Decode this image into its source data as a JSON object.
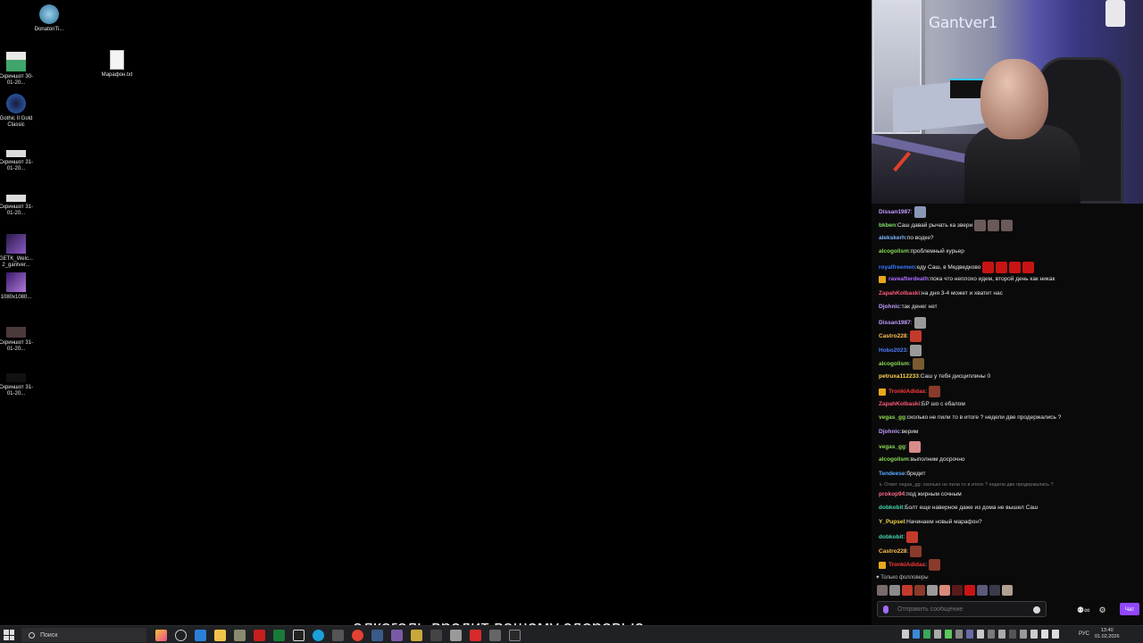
{
  "desktop": {
    "icons": [
      {
        "label": "DonatonTi...",
        "color": "#5aa0c8"
      },
      {
        "label": "Скриншот 30-01-20...",
        "color": "#3fa56a"
      },
      {
        "label": "Марафон.txt",
        "color": "#eeeeee"
      },
      {
        "label": "Gothic II Gold Classic",
        "color": "#2c6ac4"
      },
      {
        "label": "Скриншот 31-01-20...",
        "color": "#dcdcdc"
      },
      {
        "label": "Скриншот 31-01-20...",
        "color": "#dcdcdc"
      },
      {
        "label": "GETK_Welc... 2_gantver...",
        "color": "#5b3a8c"
      },
      {
        "label": "1080x1080...",
        "color": "#6b3fa0"
      },
      {
        "label": "Скриншот 31-01-20...",
        "color": "#4a3a3a"
      },
      {
        "label": "Скриншот 31-01-20...",
        "color": "#111111"
      }
    ]
  },
  "stream": {
    "streamer_name": "Gantver1"
  },
  "chat": {
    "messages": [
      {
        "user": "Dissan1987",
        "color": "#c29dff",
        "text": "",
        "emotes": [
          "#8a96b8"
        ],
        "badge": false
      },
      {
        "user": "bkben",
        "color": "#7ee06a",
        "text": "Саш давай рычать ка звери",
        "emotes": [
          "#6a5a5a",
          "#6a5a5a",
          "#6a5a5a"
        ],
        "badge": false
      },
      {
        "user": "alekskerh",
        "color": "#7ab7ff",
        "text": "по водке?",
        "emotes": [],
        "badge": false
      },
      {
        "user": "alcogolism",
        "color": "#8bdb55",
        "text": "проблемный курьер",
        "emotes": [],
        "badge": false
      },
      {
        "user": "royalfreemen",
        "color": "#3b78ff",
        "text": "еду Саш, в Медведково",
        "emotes": [
          "#c81414",
          "#c81414",
          "#c81414",
          "#c81414"
        ],
        "badge": false
      },
      {
        "user": "raveafterdeath",
        "color": "#b26dff",
        "text": "пока что неплохо идем, второй день как никак",
        "emotes": [],
        "badge": true
      },
      {
        "user": "ZapahKolbaski",
        "color": "#ff5a7a",
        "text": "на дня 3-4 может и хватит нас",
        "emotes": [],
        "badge": false
      },
      {
        "user": "Djohnic",
        "color": "#c29dff",
        "text": "так денег нет",
        "emotes": [],
        "badge": false
      },
      {
        "user": "Dissan1987",
        "color": "#c29dff",
        "text": "",
        "emotes": [
          "#9a9a9a"
        ],
        "badge": false
      },
      {
        "user": "Castro228",
        "color": "#ffc04d",
        "text": "",
        "emotes": [
          "#c43a2a"
        ],
        "badge": false
      },
      {
        "user": "Hobo2023",
        "color": "#4f7dff",
        "text": "",
        "emotes": [
          "#9a9a9a"
        ],
        "badge": false
      },
      {
        "user": "alcogolism",
        "color": "#8bdb55",
        "text": "",
        "emotes": [
          "#7a5a30"
        ],
        "badge": false
      },
      {
        "user": "petruxa112233",
        "color": "#ffd24d",
        "text": "Саш у тебя дисциплины 0",
        "emotes": [],
        "badge": false
      },
      {
        "user": "TronkiAdidas",
        "color": "#ff3b3b",
        "text": "",
        "emotes": [
          "#8a3a2a"
        ],
        "badge": true
      },
      {
        "user": "ZapahKolbaski",
        "color": "#ff5a7a",
        "text": "БР шо с ебалом",
        "emotes": [],
        "badge": false
      },
      {
        "user": "vegas_gg",
        "color": "#8bdb55",
        "text": "сколько не пили то в итоге ? недели две продержались ?",
        "emotes": [],
        "badge": false
      },
      {
        "user": "Djohnic",
        "color": "#c29dff",
        "text": "верим",
        "emotes": [],
        "badge": false
      },
      {
        "user": "vegas_gg",
        "color": "#8bdb55",
        "text": "",
        "emotes": [
          "#d98a8a"
        ],
        "badge": false
      },
      {
        "user": "alcogolism",
        "color": "#8bdb55",
        "text": "выполним досрочно",
        "emotes": [],
        "badge": false
      },
      {
        "user": "Tendeese",
        "color": "#5aaaff",
        "text": "бредит",
        "emotes": [],
        "badge": false
      },
      {
        "user": "prokop94",
        "color": "#ff6b8a",
        "text": "под жирным сочным",
        "emotes": [],
        "badge": false
      },
      {
        "user": "dobkobit",
        "color": "#46d8b0",
        "text": "Болт еще наверное даже из дома не вышел Саш",
        "emotes": [],
        "badge": false
      },
      {
        "user": "Y_Pupsel",
        "color": "#f6d84a",
        "text": "Начинаем новый марафон?",
        "emotes": [],
        "badge": false
      },
      {
        "user": "dobkobit",
        "color": "#46d8b0",
        "text": "",
        "emotes": [
          "#c43a2a"
        ],
        "badge": false
      },
      {
        "user": "Castro228",
        "color": "#ffc04d",
        "text": "",
        "emotes": [
          "#8a3a2a"
        ],
        "badge": false
      },
      {
        "user": "TronkiAdidas",
        "color": "#ff3b3b",
        "text": "",
        "emotes": [
          "#8a3a2a"
        ],
        "badge": true
      }
    ],
    "reply_text": "↳ Ответ vegas_gg: сколько не пили то в итоге ? недели две продержались ?",
    "followers_label": "♥ Только фолловеры",
    "input_placeholder": "Отправить сообщение",
    "send_label": "Чат"
  },
  "subtitle": "алкоголь вредит вашему здоровью",
  "taskbar": {
    "search_label": "Поиск",
    "lang": "РУС",
    "time": "13:40",
    "date": "01.02.2026"
  }
}
